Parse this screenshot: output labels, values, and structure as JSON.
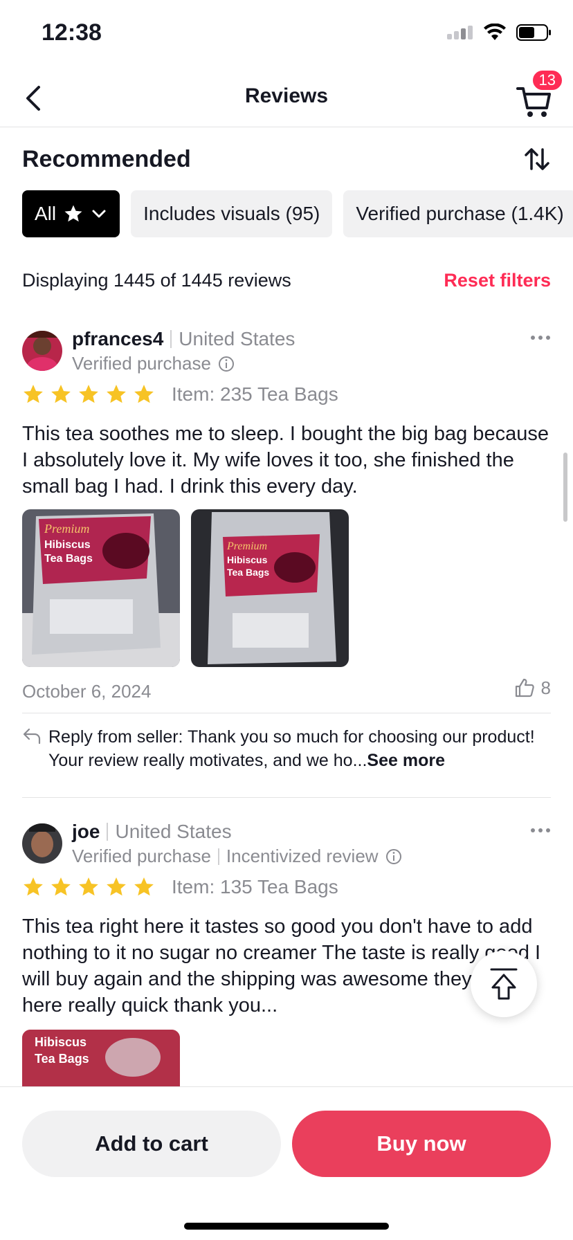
{
  "status_bar": {
    "time": "12:38"
  },
  "nav": {
    "title": "Reviews",
    "cart_count": "13"
  },
  "section": {
    "title": "Recommended"
  },
  "filters": [
    {
      "label": "All"
    },
    {
      "label": "Includes visuals (95)"
    },
    {
      "label": "Verified purchase (1.4K)"
    }
  ],
  "summary": {
    "count_text": "Displaying 1445 of 1445 reviews",
    "reset_label": "Reset filters"
  },
  "reviews": [
    {
      "username": "pfrances4",
      "country": "United States",
      "badges": [
        "Verified purchase"
      ],
      "rating": 5,
      "item": "Item: 235 Tea Bags",
      "text": "This tea soothes me to sleep. I bought the big bag because I absolutely love it. My wife loves it too, she finished the small bag I had. I drink this every day.",
      "photo_labels": [
        "Premium",
        "Hibiscus",
        "Tea Bags"
      ],
      "date": "October 6, 2024",
      "likes": "8",
      "reply": "Reply from seller: Thank you so much for choosing our product! Your review really motivates, and we ho...",
      "see_more": "See more"
    },
    {
      "username": "joe",
      "country": "United States",
      "badges": [
        "Verified purchase",
        "Incentivized review"
      ],
      "rating": 5,
      "item": "Item: 135 Tea Bags",
      "text": "This tea right here it tastes so good you don't have to add nothing to it no sugar no creamer The taste is really good I will buy again and the shipping was awesome they got here really quick thank you...",
      "photo_labels": [
        "Hibiscus",
        "Tea Bags"
      ]
    }
  ],
  "bottom": {
    "add_to_cart": "Add to cart",
    "buy_now": "Buy now"
  },
  "colors": {
    "accent": "#fe2c55",
    "buy_button": "#ea3f5c",
    "star": "#f7c325",
    "chip_bg": "#f1f1f2"
  }
}
